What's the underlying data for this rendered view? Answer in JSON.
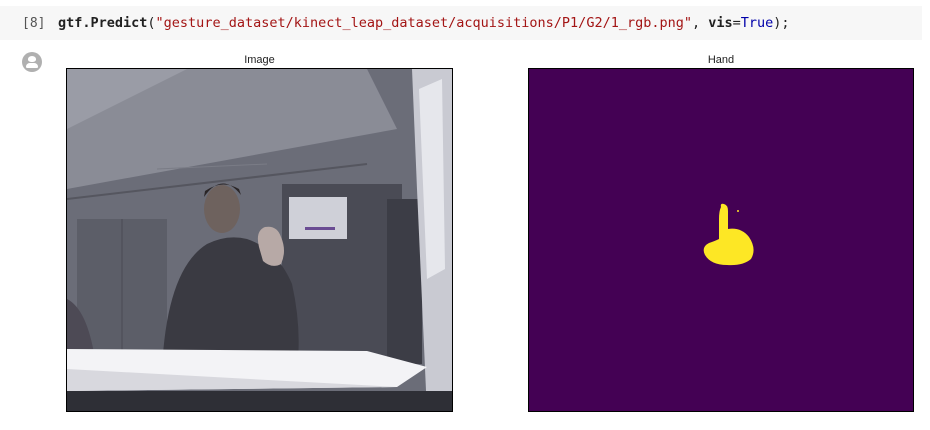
{
  "cell": {
    "execution_count": "[8]",
    "code": {
      "func": "gtf.Predict",
      "open": "(",
      "path": "\"gesture_dataset/kinect_leap_dataset/acquisitions/P1/G2/1_rgb.png\"",
      "sep": ", ",
      "kwarg": "vis",
      "eq": "=",
      "value": "True",
      "close": ");"
    }
  },
  "output": {
    "icon": "output-avatar-icon",
    "plots": [
      {
        "title": "Image",
        "content": "rgb-frame"
      },
      {
        "title": "Hand",
        "content": "segmentation-mask"
      }
    ]
  },
  "colors": {
    "mask_background": "#440154",
    "mask_foreground": "#fde725"
  }
}
